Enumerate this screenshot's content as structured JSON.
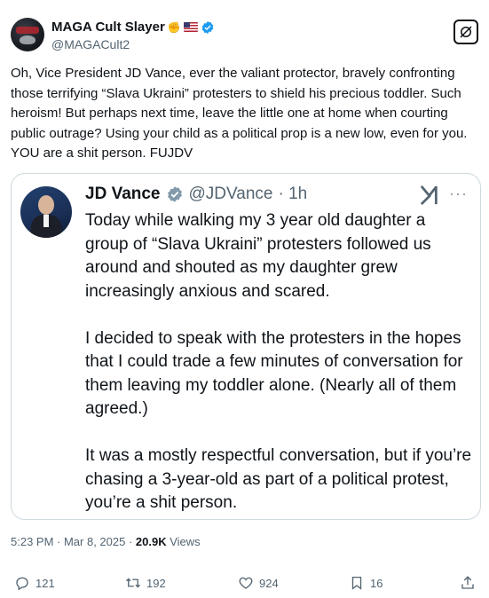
{
  "author": {
    "display_name": "MAGA Cult Slayer",
    "emojis": [
      "hand-raised-fist-emoji",
      "us-flag-emoji"
    ],
    "handle": "@MAGACult2",
    "verified": true
  },
  "tweet": {
    "text": "Oh, Vice President JD Vance, ever the valiant protector, bravely confronting those terrifying “Slava Ukraini” protesters to shield his precious toddler. Such heroism! But perhaps next time, leave the little one at home when courting public outrage? Using your child as a political prop is a new low, even for you. YOU are a shit person. FUJDV"
  },
  "quote": {
    "display_name": "JD Vance",
    "handle": "@JDVance",
    "time": "· 1h",
    "more": "···",
    "paragraphs": [
      "Today while walking my 3 year old daughter a group of “Slava Ukraini” protesters followed us around and shouted as my daughter grew increasingly anxious and scared.",
      "I decided to speak with the protesters in the hopes that I could trade a few minutes of conversation for them leaving my toddler alone. (Nearly all of them agreed.)",
      "It was a mostly respectful conversation,  but if you’re chasing a 3-year-old as part of a political protest, you’re a shit person."
    ]
  },
  "meta": {
    "time": "5:23 PM · Mar 8, 2025 · ",
    "views_count": "20.9K",
    "views_label": " Views"
  },
  "actions": {
    "replies": "121",
    "reposts": "192",
    "likes": "924",
    "bookmarks": "16"
  },
  "colors": {
    "text": "#0f1419",
    "secondary": "#536471",
    "verified_blue": "#1d9bf0",
    "border": "#cfd9de"
  }
}
